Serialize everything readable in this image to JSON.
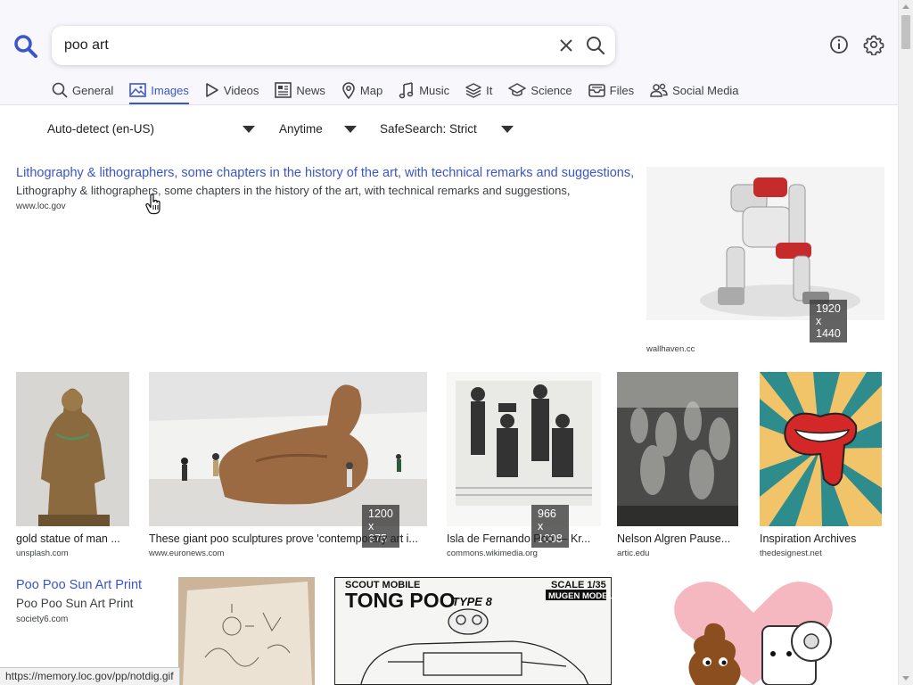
{
  "search": {
    "query": "poo art"
  },
  "tabs": [
    {
      "label": "General",
      "icon": "search-icon"
    },
    {
      "label": "Images",
      "icon": "image-icon",
      "active": true
    },
    {
      "label": "Videos",
      "icon": "play-icon"
    },
    {
      "label": "News",
      "icon": "newspaper-icon"
    },
    {
      "label": "Map",
      "icon": "map-pin-icon"
    },
    {
      "label": "Music",
      "icon": "music-note-icon"
    },
    {
      "label": "It",
      "icon": "layers-icon"
    },
    {
      "label": "Science",
      "icon": "graduation-cap-icon"
    },
    {
      "label": "Files",
      "icon": "inbox-icon"
    },
    {
      "label": "Social Media",
      "icon": "people-icon"
    }
  ],
  "filters": {
    "language": "Auto-detect (en-US)",
    "time": "Anytime",
    "safesearch": "SafeSearch: Strict"
  },
  "results": {
    "lithography": {
      "title": "Lithography & lithographers, some chapters in the history of the art, with technical remarks and suggestions,",
      "snippet": "Lithography & lithographers, some chapters in the history of the art, with technical remarks and suggestions,",
      "url": "www.loc.gov"
    },
    "robot": {
      "dims": "1920 x 1440",
      "source": "wallhaven.cc"
    },
    "row2": [
      {
        "caption": "gold statue of man ...",
        "source": "unsplash.com"
      },
      {
        "caption": "These giant poo sculptures prove 'contemporary art i...",
        "source": "www.euronews.com",
        "dims": "1200 x 675"
      },
      {
        "caption": "Isla de Fernando Poo — Kr...",
        "source": "commons.wikimedia.org",
        "dims": "966 x 1008"
      },
      {
        "caption": "Nelson Algren Pause...",
        "source": "artic.edu"
      },
      {
        "caption": "Inspiration Archives",
        "source": "thedesignest.net"
      }
    ],
    "poo_sun": {
      "title": "Poo Poo Sun Art Print",
      "snippet": "Poo Poo Sun Art Print",
      "url": "society6.com"
    },
    "tong_poo": {
      "line1": "SCOUT MOBILE",
      "line2": "TONG POO",
      "line3": "TYPE 8",
      "scale": "SCALE 1/35",
      "model": "MUGEN MODEL"
    }
  },
  "status_bar": {
    "url": "https://memory.loc.gov/pp/notdig.gif"
  }
}
